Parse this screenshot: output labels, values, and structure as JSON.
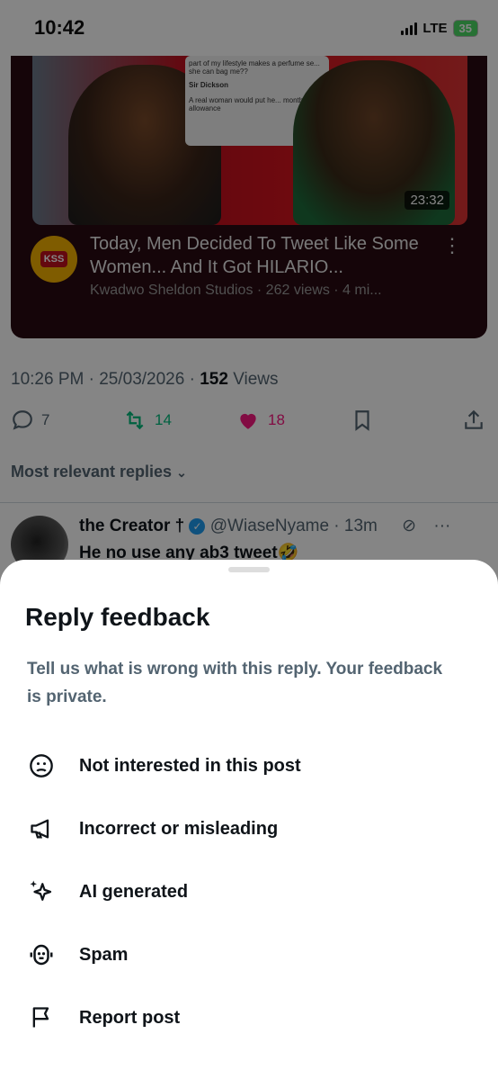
{
  "status": {
    "time": "10:42",
    "network": "LTE",
    "battery": "35"
  },
  "video": {
    "duration": "23:32",
    "channel_logo_text": "KSS",
    "title": "Today, Men Decided To Tweet Like Some Women... And It Got HILARIO...",
    "meta": "Kwadwo Sheldon Studios · 262 views · 4 mi...",
    "bubble_text": "part of my lifestyle makes a perfume se... she can bag me??",
    "bubble_user": "Sir Dickson",
    "bubble_reply": "A real woman would put he... monthly allowance"
  },
  "post": {
    "time": "10:26 PM",
    "date": "25/03/2026",
    "views_count": "152",
    "views_label": "Views",
    "replies": "7",
    "reposts": "14",
    "likes": "18"
  },
  "replies_sort": "Most relevant replies",
  "reply": {
    "name": "the Creator †",
    "handle": "@WiaseNyame",
    "time": "13m",
    "text": "He no use any ab3 tweet🤣"
  },
  "sheet": {
    "title": "Reply feedback",
    "subtitle": "Tell us what is wrong with this reply. Your feedback is private.",
    "options": [
      {
        "label": "Not interested in this post",
        "icon": "frown-icon"
      },
      {
        "label": "Incorrect or misleading",
        "icon": "megaphone-icon"
      },
      {
        "label": "AI generated",
        "icon": "sparkle-icon"
      },
      {
        "label": "Spam",
        "icon": "robot-icon"
      },
      {
        "label": "Report post",
        "icon": "flag-icon"
      }
    ]
  },
  "colors": {
    "like": "#f91880",
    "repost": "#00ba7c",
    "verified": "#1d9bf0"
  }
}
